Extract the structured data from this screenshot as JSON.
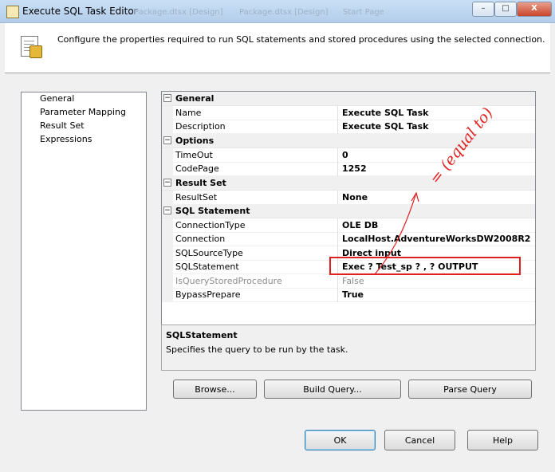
{
  "window": {
    "title": "Execute SQL Task Editor",
    "background_tabs": [
      "Package.dtsx [Design]",
      "Package.dtsx [Design]",
      "Start Page"
    ],
    "minimize_glyph": "–",
    "maximize_glyph": "□",
    "close_glyph": "X"
  },
  "header": {
    "description": "Configure the properties required to run SQL statements and stored procedures using the selected connection."
  },
  "nav": {
    "items": [
      "General",
      "Parameter Mapping",
      "Result Set",
      "Expressions"
    ]
  },
  "properties": {
    "expand_glyph": "−",
    "categories": [
      {
        "title": "General",
        "rows": [
          {
            "name": "Name",
            "value": "Execute SQL Task"
          },
          {
            "name": "Description",
            "value": "Execute SQL Task"
          }
        ]
      },
      {
        "title": "Options",
        "rows": [
          {
            "name": "TimeOut",
            "value": "0"
          },
          {
            "name": "CodePage",
            "value": "1252"
          }
        ]
      },
      {
        "title": "Result Set",
        "rows": [
          {
            "name": "ResultSet",
            "value": "None"
          }
        ]
      },
      {
        "title": "SQL Statement",
        "rows": [
          {
            "name": "ConnectionType",
            "value": "OLE DB"
          },
          {
            "name": "Connection",
            "value": "LocalHost.AdventureWorksDW2008R2"
          },
          {
            "name": "SQLSourceType",
            "value": "Direct input"
          },
          {
            "name": "SQLStatement",
            "value": "Exec ? Test_sp ? , ? OUTPUT"
          },
          {
            "name": "IsQueryStoredProcedure",
            "value": "False",
            "disabled": true
          },
          {
            "name": "BypassPrepare",
            "value": "True"
          }
        ]
      }
    ]
  },
  "description_panel": {
    "title": "SQLStatement",
    "text": "Specifies the query to be run by the task."
  },
  "action_buttons": {
    "browse": "Browse...",
    "build_query": "Build Query...",
    "parse_query": "Parse Query"
  },
  "dialog_buttons": {
    "ok": "OK",
    "cancel": "Cancel",
    "help": "Help"
  },
  "annotation": {
    "text": "= (equal to)",
    "color": "#e02020"
  }
}
